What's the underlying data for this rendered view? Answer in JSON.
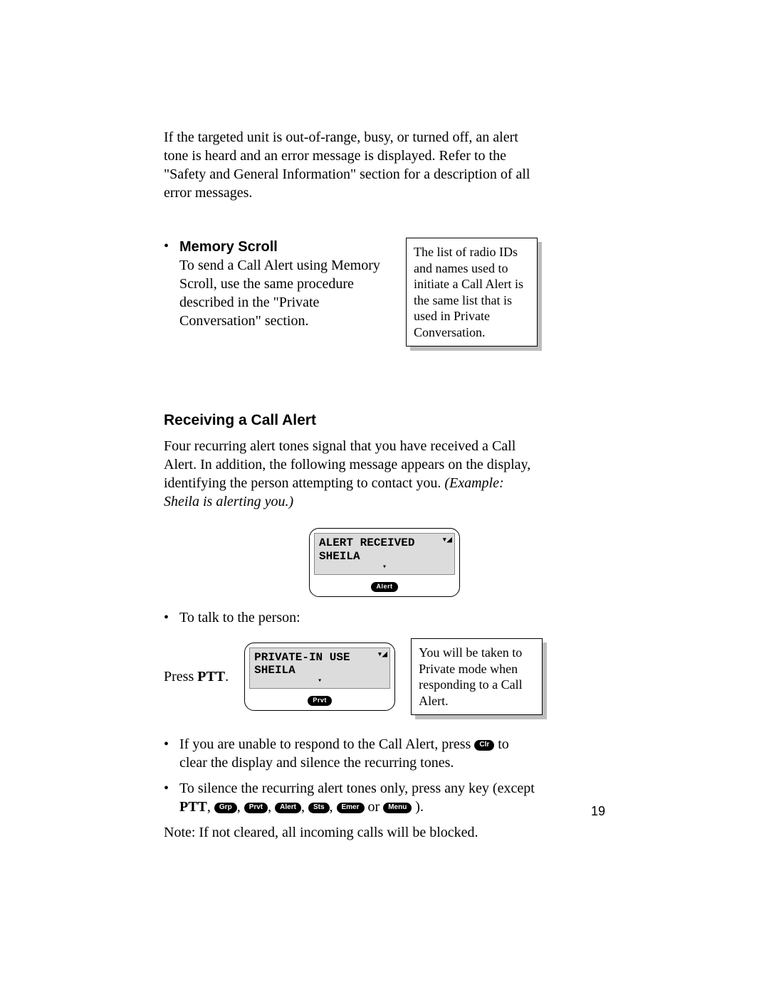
{
  "intro": "If the targeted unit is out-of-range, busy, or turned off, an alert tone is heard and an error message is displayed. Refer to the \"Safety and General Information\" section for a description of all error messages.",
  "memory": {
    "title": "Memory Scroll",
    "body": "To send a Call Alert using Memory Scroll, use the same procedure described in the \"Private Conversation\" section.",
    "note": "The list of radio IDs and names used to initiate a Call Alert is the same list that is used in Private Conversation."
  },
  "section": {
    "heading": "Receiving a Call Alert",
    "body_pre": "Four recurring alert tones signal that you have received a Call Alert. In addition, the following message appears on the display, identifying the person attempting to contact you. ",
    "body_italic": "(Example: Sheila is alerting you.)"
  },
  "lcd1": {
    "line1": "ALERT RECEIVED",
    "line2": "SHEILA",
    "button": "Alert"
  },
  "talk_bullet": "To talk to the person:",
  "press": {
    "prefix": "Press ",
    "key": "PTT",
    "suffix": "."
  },
  "lcd2": {
    "line1": "PRIVATE-IN USE",
    "line2": "SHEILA",
    "button": "Prvt"
  },
  "note_private": "You will be taken to Private mode when responding to a Call Alert.",
  "unable": {
    "pre": "If you are unable to respond to the Call Alert, press ",
    "key": "Clr",
    "post": " to clear the display and silence the recurring tones."
  },
  "silence": {
    "pre": "To silence the recurring alert tones only, press any key (except ",
    "ptt": "PTT",
    "keys": [
      "Grp",
      "Prvt",
      "Alert",
      "Sts",
      "Emer",
      "Menu"
    ],
    "sep_comma": ", ",
    "or": " or ",
    "close": " )."
  },
  "final_note": "Note: If not cleared, all incoming calls will be blocked.",
  "page_number": "19",
  "icons": {
    "signal": "▾◢",
    "triangle": "▾"
  }
}
